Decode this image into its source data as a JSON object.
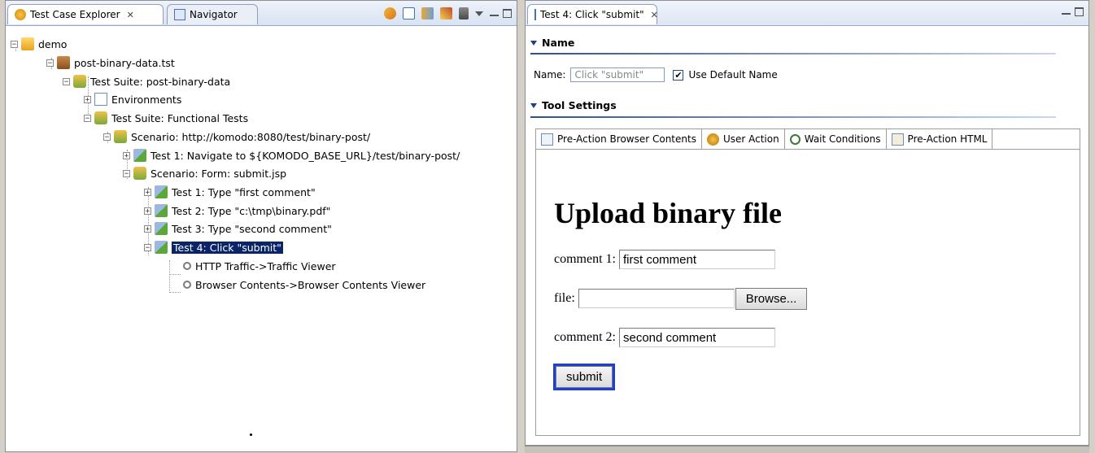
{
  "left_view": {
    "tabs": [
      {
        "label": "Test Case Explorer",
        "close": "✕"
      },
      {
        "label": "Navigator"
      }
    ],
    "toolbar_icons": [
      "sync-icon",
      "collapse-icon",
      "link-icon",
      "pin-icon",
      "filter-icon"
    ]
  },
  "tree": [
    {
      "label": "demo",
      "icon": "folder"
    },
    {
      "label": "post-binary-data.tst",
      "icon": "file"
    },
    {
      "label": "Test Suite: post-binary-data",
      "icon": "suite"
    },
    {
      "label": "Environments",
      "icon": "env"
    },
    {
      "label": "Test Suite: Functional Tests",
      "icon": "suite"
    },
    {
      "label": "Scenario: http://komodo:8080/test/binary-post/",
      "icon": "suite"
    },
    {
      "label": "Test 1: Navigate to ${KOMODO_BASE_URL}/test/binary-post/",
      "icon": "test"
    },
    {
      "label": "Scenario: Form: submit.jsp",
      "icon": "suite"
    },
    {
      "label": "Test 1: Type \"first comment\"",
      "icon": "test"
    },
    {
      "label": "Test 2: Type \"c:\\tmp\\binary.pdf\"",
      "icon": "test"
    },
    {
      "label": "Test 3: Type \"second comment\"",
      "icon": "test"
    },
    {
      "label": "Test 4: Click \"submit\"",
      "icon": "test",
      "selected": true
    },
    {
      "label": "HTTP Traffic->Traffic Viewer",
      "icon": "view"
    },
    {
      "label": "Browser Contents->Browser Contents Viewer",
      "icon": "view"
    }
  ],
  "editor": {
    "tab_label": "Test 4: Click \"submit\"",
    "tab_close": "✕",
    "section_name": "Name",
    "name_label": "Name:",
    "name_value": "Click \"submit\"",
    "use_default_label": "Use Default Name",
    "use_default_checked": true,
    "section_tool": "Tool Settings",
    "tool_tabs": [
      "Pre-Action Browser Contents",
      "User Action",
      "Wait Conditions",
      "Pre-Action HTML"
    ],
    "browser": {
      "heading": "Upload binary file",
      "comment1_label": "comment 1:",
      "comment1_value": "first comment",
      "file_label": "file:",
      "file_value": "",
      "browse_label": "Browse...",
      "comment2_label": "comment 2:",
      "comment2_value": "second comment",
      "submit_label": "submit"
    }
  }
}
